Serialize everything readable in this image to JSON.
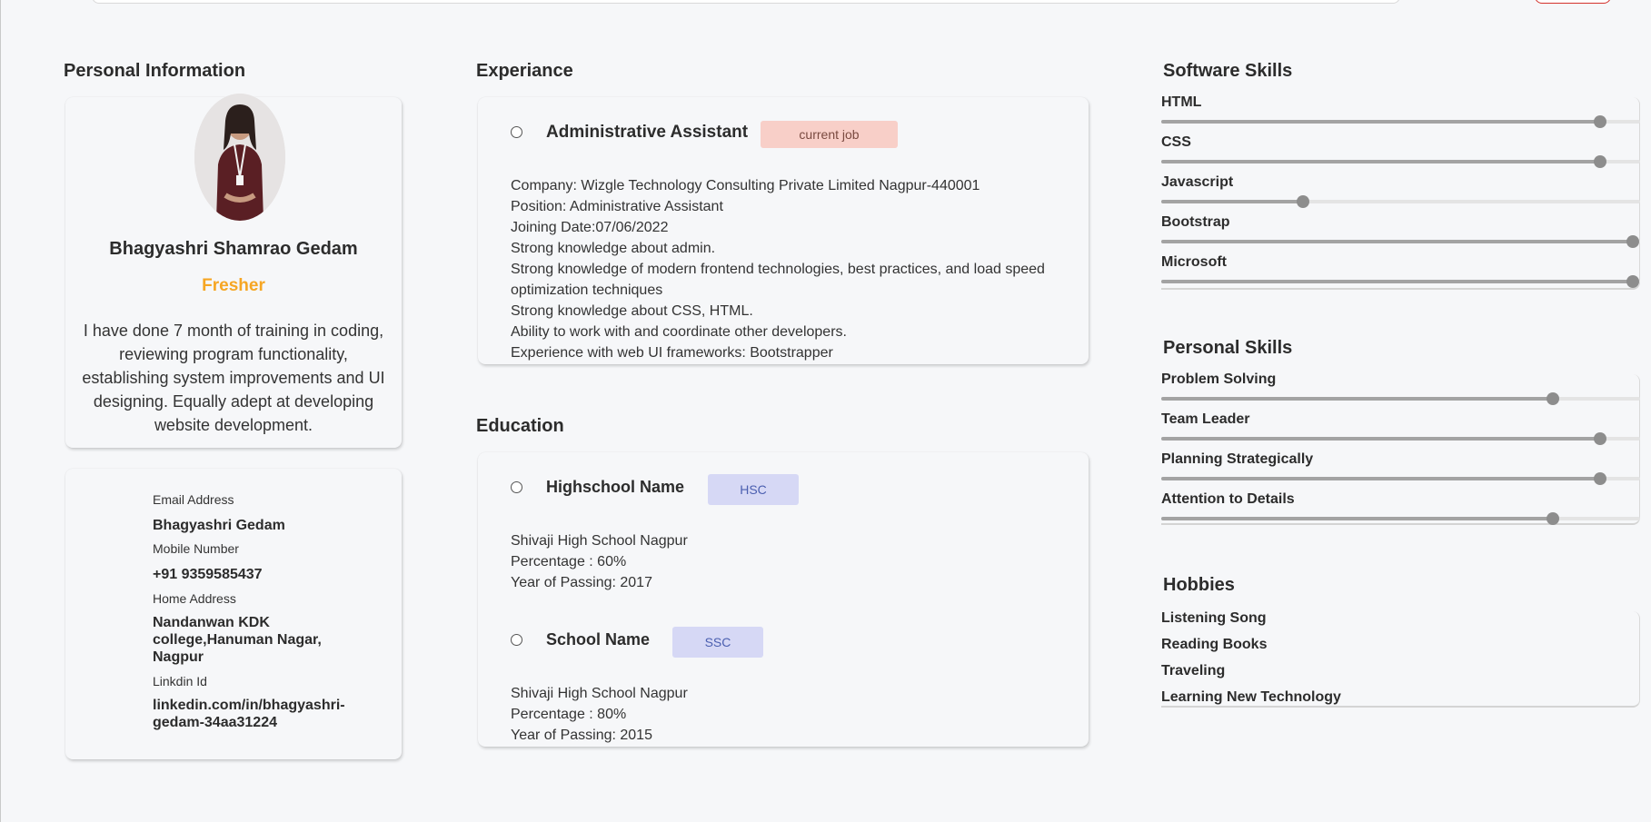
{
  "personal": {
    "title": "Personal Information",
    "name": "Bhagyashri Shamrao Gedam",
    "role": "Fresher",
    "bio": "I have done 7 month of training in coding, reviewing program functionality, establishing system improvements and UI designing. Equally adept at developing website development.",
    "contact": {
      "email_label": "Email Address",
      "email_value": "Bhagyashri Gedam",
      "mobile_label": "Mobile Number",
      "mobile_value": "+91 9359585437",
      "address_label": "Home Address",
      "address_value": "Nandanwan KDK college,Hanuman Nagar, Nagpur",
      "linkedin_label": "Linkdin Id",
      "linkedin_value": "linkedin.com/in/bhagyashri-gedam-34aa31224"
    }
  },
  "experience": {
    "title": "Experiance",
    "job_title": "Administrative Assistant",
    "badge": "current job",
    "lines": [
      "Company: Wizgle Technology Consulting Private Limited Nagpur-440001",
      "Position: Administrative Assistant",
      "Joining Date:07/06/2022",
      "Strong knowledge about admin.",
      "Strong knowledge of modern frontend technologies, best practices, and load speed optimization techniques",
      "Strong knowledge about CSS, HTML.",
      "Ability to work with and coordinate other developers.",
      "Experience with web UI frameworks: Bootstrapper"
    ]
  },
  "education": {
    "title": "Education",
    "entries": [
      {
        "name": "Highschool Name",
        "badge": "HSC",
        "school": "Shivaji High School Nagpur",
        "percentage": "Percentage : 60%",
        "year": "Year of Passing: 2017"
      },
      {
        "name": "School Name",
        "badge": "SSC",
        "school": "Shivaji High School Nagpur",
        "percentage": "Percentage : 80%",
        "year": "Year of Passing: 2015"
      }
    ]
  },
  "software_skills": {
    "title": "Software Skills",
    "items": [
      {
        "label": "HTML",
        "level": 0.93
      },
      {
        "label": "CSS",
        "level": 0.93
      },
      {
        "label": "Javascript",
        "level": 0.3
      },
      {
        "label": "Bootstrap",
        "level": 1.0
      },
      {
        "label": "Microsoft",
        "level": 1.0
      }
    ]
  },
  "personal_skills": {
    "title": "Personal Skills",
    "items": [
      {
        "label": "Problem Solving",
        "level": 0.83
      },
      {
        "label": "Team Leader",
        "level": 0.93
      },
      {
        "label": "Planning Strategically",
        "level": 0.93
      },
      {
        "label": "Attention to Details",
        "level": 0.83
      }
    ]
  },
  "hobbies": {
    "title": "Hobbies",
    "items": [
      "Listening Song",
      "Reading Books",
      "Traveling",
      "Learning New Technology"
    ]
  },
  "colors": {
    "role_accent": "#f6a623",
    "job_badge_bg": "#f8cfc8",
    "edu_badge_bg": "#d6d8f5"
  }
}
